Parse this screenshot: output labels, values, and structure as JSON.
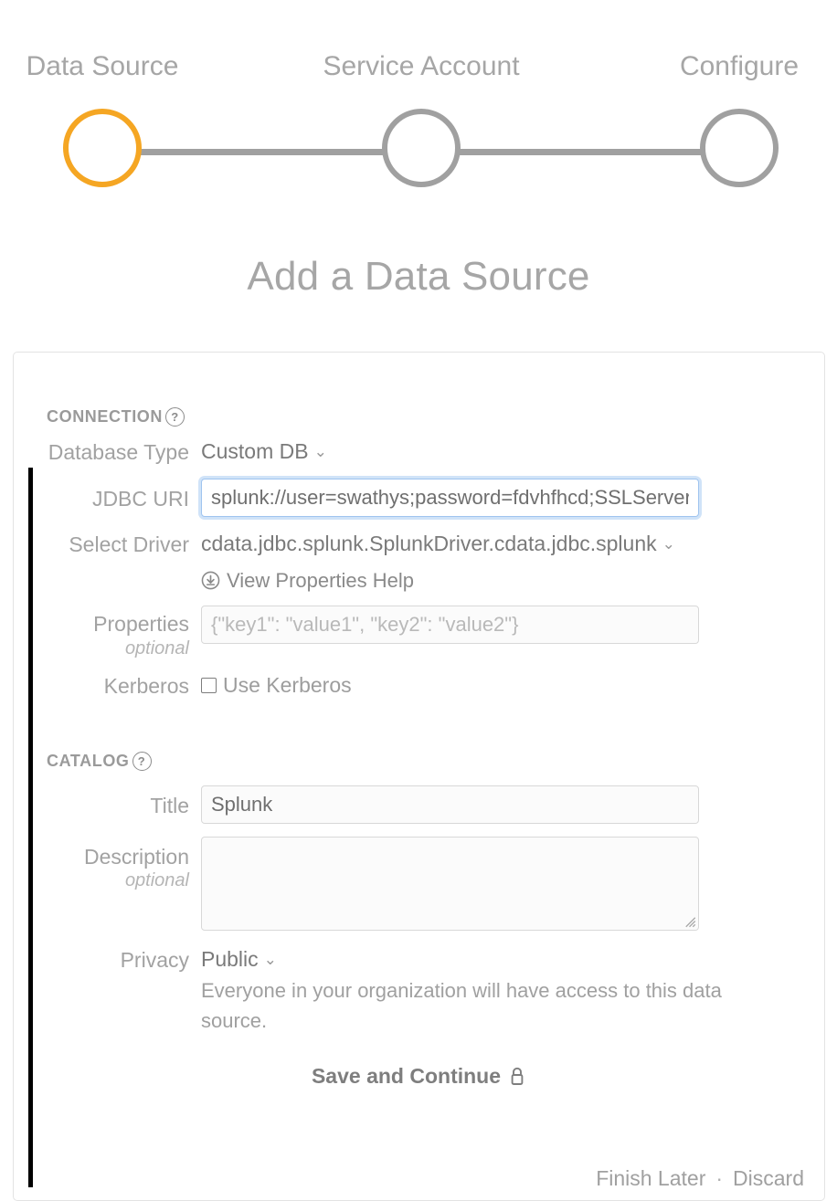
{
  "stepper": {
    "steps": [
      {
        "label": "Data Source",
        "state": "active"
      },
      {
        "label": "Service Account",
        "state": "inactive"
      },
      {
        "label": "Configure",
        "state": "inactive"
      }
    ],
    "active_color": "#f5a623",
    "inactive_color": "#a0a0a0"
  },
  "page": {
    "title": "Add a Data Source"
  },
  "connection": {
    "section_label": "CONNECTION",
    "help_glyph": "?",
    "database_type": {
      "label": "Database Type",
      "value": "Custom DB",
      "chevron": "⌄"
    },
    "jdbc_uri": {
      "label": "JDBC URI",
      "value": "splunk://user=swathys;password=fdvhfhcd;SSLServerCert",
      "placeholder": ""
    },
    "select_driver": {
      "label": "Select Driver",
      "value": "cdata.jdbc.splunk.SplunkDriver.cdata.jdbc.splunk",
      "chevron": "⌄"
    },
    "properties_help_link": "View Properties Help",
    "properties": {
      "label": "Properties",
      "optional": "optional",
      "value": "",
      "placeholder": "{\"key1\": \"value1\", \"key2\": \"value2\"}"
    },
    "kerberos": {
      "label": "Kerberos",
      "checkbox_label": "Use Kerberos",
      "checked": false
    }
  },
  "catalog": {
    "section_label": "CATALOG",
    "help_glyph": "?",
    "title_field": {
      "label": "Title",
      "value": "Splunk",
      "placeholder": ""
    },
    "description_field": {
      "label": "Description",
      "optional": "optional",
      "value": "",
      "placeholder": ""
    },
    "privacy": {
      "label": "Privacy",
      "value": "Public",
      "chevron": "⌄",
      "description": "Everyone in your organization will have access to this data source."
    }
  },
  "actions": {
    "save_label": "Save and Continue",
    "finish_later_label": "Finish Later",
    "separator": "·",
    "discard_label": "Discard"
  }
}
